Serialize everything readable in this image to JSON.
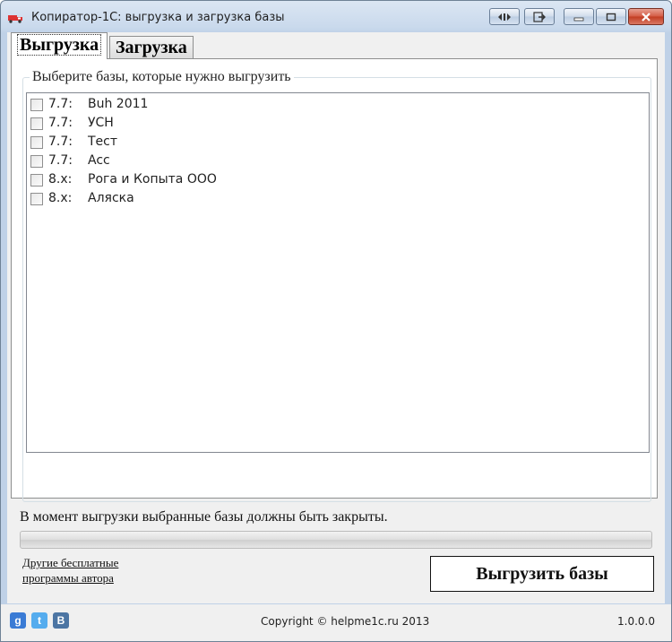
{
  "window": {
    "title": "Копиратор-1С: выгрузка и загрузка базы"
  },
  "tabs": [
    {
      "label": "Выгрузка",
      "active": true
    },
    {
      "label": "Загрузка",
      "active": false
    }
  ],
  "export_panel": {
    "group_label": "Выберите базы, которые нужно выгрузить",
    "databases": [
      {
        "version": "7.7:",
        "name": "Buh 2011",
        "checked": false
      },
      {
        "version": "7.7:",
        "name": "УСН",
        "checked": false
      },
      {
        "version": "7.7:",
        "name": "Тест",
        "checked": false
      },
      {
        "version": "7.7:",
        "name": "Acc",
        "checked": false
      },
      {
        "version": "8.x:",
        "name": "Рога и Копыта ООО",
        "checked": false
      },
      {
        "version": "8.x:",
        "name": "Аляска",
        "checked": false
      }
    ]
  },
  "notice": "В момент выгрузки выбранные базы должны быть закрыты.",
  "progress": {
    "percent": 0
  },
  "links": {
    "line1": "Другие бесплатные",
    "line2": "программы автора"
  },
  "actions": {
    "export_label": "Выгрузить базы"
  },
  "status_bar": {
    "social": [
      {
        "icon": "google-plus-icon",
        "glyph": "g",
        "color": "#3a7bd5"
      },
      {
        "icon": "twitter-icon",
        "glyph": "t",
        "color": "#55acee"
      },
      {
        "icon": "vk-icon",
        "glyph": "B",
        "color": "#4c75a3"
      }
    ],
    "copyright": "Copyright © helpme1c.ru 2013",
    "version": "1.0.0.0"
  }
}
